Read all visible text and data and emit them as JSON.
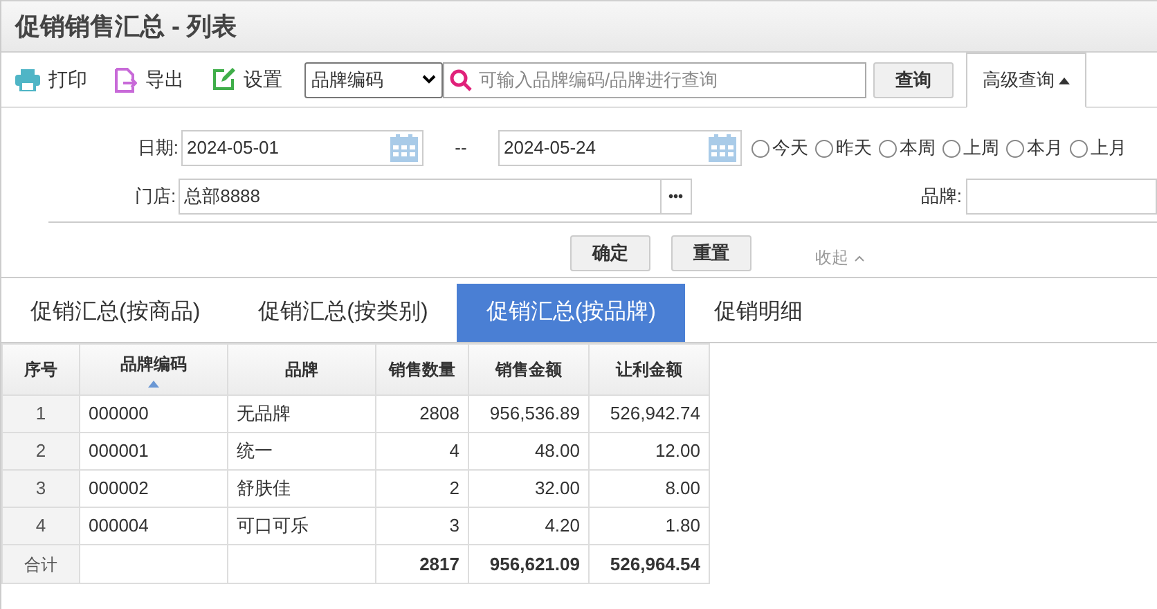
{
  "window": {
    "title": "促销销售汇总 - 列表"
  },
  "toolbar": {
    "buttons": [
      {
        "label": "打印",
        "kind": "print"
      },
      {
        "label": "导出",
        "kind": "export"
      },
      {
        "label": "设置",
        "kind": "settings"
      }
    ],
    "search_by": "品牌编码",
    "search": {
      "placeholder": "可输入品牌编码/品牌进行查询"
    },
    "search_button": "查询",
    "advanced": {
      "label": "高级查询",
      "expanded": true
    }
  },
  "filters": {
    "date_label": "日期:",
    "date_from": "2024-05-01",
    "date_sep": "--",
    "date_to": "2024-05-24",
    "quick_dates": [
      {
        "label": "今天",
        "selected": false
      },
      {
        "label": "昨天",
        "selected": false
      },
      {
        "label": "本周",
        "selected": false
      },
      {
        "label": "上周",
        "selected": false
      },
      {
        "label": "本月",
        "selected": false
      },
      {
        "label": "上月",
        "selected": false
      }
    ],
    "store_label": "门店:",
    "store": "总部8888",
    "browse_button": "•••",
    "brand_label": "品牌:",
    "confirm": "确定",
    "reset": "重置",
    "collapse": "收起"
  },
  "tabs": [
    {
      "label": "促销汇总(按商品)",
      "selected": false
    },
    {
      "label": "促销汇总(按类别)",
      "selected": false
    },
    {
      "label": "促销汇总(按品牌)",
      "selected": true
    },
    {
      "label": "促销明细",
      "selected": false
    }
  ],
  "table": {
    "columns": [
      {
        "label": "序号",
        "sorted": false
      },
      {
        "label": "品牌编码",
        "sorted": true
      },
      {
        "label": "品牌",
        "sorted": false
      },
      {
        "label": "销售数量",
        "sorted": false
      },
      {
        "label": "销售金额",
        "sorted": false
      },
      {
        "label": "让利金额",
        "sorted": false
      }
    ],
    "rows": [
      [
        "1",
        "000000",
        "无品牌",
        "2808",
        "956,536.89",
        "526,942.74"
      ],
      [
        "2",
        "000001",
        "统一",
        "4",
        "48.00",
        "12.00"
      ],
      [
        "3",
        "000002",
        "舒肤佳",
        "2",
        "32.00",
        "8.00"
      ],
      [
        "4",
        "000004",
        "可口可乐",
        "3",
        "4.20",
        "1.80"
      ]
    ],
    "total": {
      "label": "合计",
      "quantity": "2817",
      "amount": "956,621.09",
      "discount": "526,964.54"
    }
  }
}
